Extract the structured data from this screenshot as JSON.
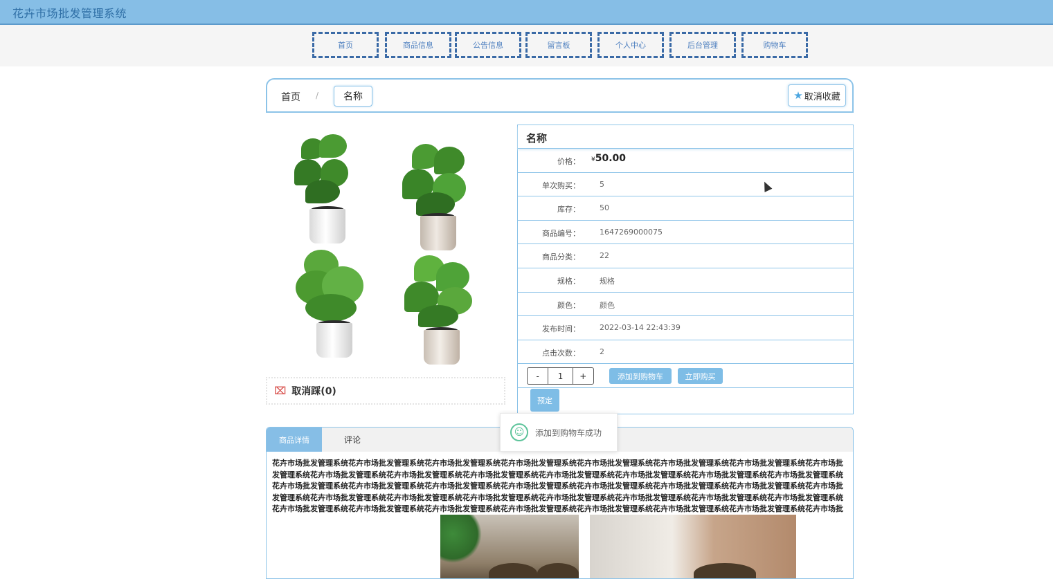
{
  "app": {
    "title": "花卉市场批发管理系统"
  },
  "nav": {
    "items": [
      {
        "label": "首页"
      },
      {
        "label": "商品信息"
      },
      {
        "label": "公告信息"
      },
      {
        "label": "留言板"
      },
      {
        "label": "个人中心"
      },
      {
        "label": "后台管理"
      },
      {
        "label": "购物车"
      }
    ]
  },
  "breadcrumb": {
    "home": "首页",
    "separator": "/",
    "current": "名称"
  },
  "favorite": {
    "label": "取消收藏",
    "icon": "star-icon"
  },
  "dislike": {
    "label": "取消踩(0)",
    "icon": "thumbs-down-icon"
  },
  "product": {
    "name": "名称",
    "fields": [
      {
        "label": "价格：",
        "value": "50.00",
        "currency": "¥"
      },
      {
        "label": "单次购买：",
        "value": "5"
      },
      {
        "label": "库存：",
        "value": "50"
      },
      {
        "label": "商品编号：",
        "value": "1647269000075"
      },
      {
        "label": "商品分类：",
        "value": "22"
      },
      {
        "label": "规格：",
        "value": "规格"
      },
      {
        "label": "颜色：",
        "value": "颜色"
      },
      {
        "label": "发布时间：",
        "value": "2022-03-14 22:43:39"
      },
      {
        "label": "点击次数：",
        "value": "2"
      }
    ],
    "quantity": {
      "minus": "-",
      "value": "1",
      "plus": "+"
    },
    "buttons": {
      "add_to_cart": "添加到购物车",
      "buy_now": "立即购买",
      "reserve": "预定"
    }
  },
  "toast": {
    "message": "添加到购物车成功",
    "icon": "smile-icon"
  },
  "detail": {
    "tabs": [
      {
        "label": "商品详情"
      },
      {
        "label": "评论"
      }
    ],
    "description": "花卉市场批发管理系统花卉市场批发管理系统花卉市场批发管理系统花卉市场批发管理系统花卉市场批发管理系统花卉市场批发管理系统花卉市场批发管理系统花卉市场批发管理系统花卉市场批发管理系统花卉市场批发管理系统花卉市场批发管理系统花卉市场批发管理系统花卉市场批发管理系统花卉市场批发管理系统花卉市场批发管理系统花卉市场批发管理系统花卉市场批发管理系统花卉市场批发管理系统花卉市场批发管理系统花卉市场批发管理系统花卉市场批发管理系统花卉市场批发管理系统花卉市场批发管理系统花卉市场批发管理系统花卉市场批发管理系统花卉市场批发管理系统花卉市场批发管理系统花卉市场批发管理系统花卉市场批发管理系统花卉市场批发管理系统花卉市场批发管理系统花卉市场批发管理系统花卉市场批发管理系统花卉市场批发管理系统花卉市场批发管理系统花卉市场批发管理系统花卉市场批发管理系统花卉市场批发管理系统花卉市场批发管理系统花卉市场批发管理系统花卉市场批发管理系统花卉市场批发管理系统花卉市场批发管理系统花卉市场批发管理系统花卉市场批发管理系统花卉市场批发管理系统"
  },
  "colors": {
    "header": "#86bee6",
    "accent": "#7ebde6",
    "border": "#8cc3e8",
    "nav_border": "#3a6aa6"
  }
}
